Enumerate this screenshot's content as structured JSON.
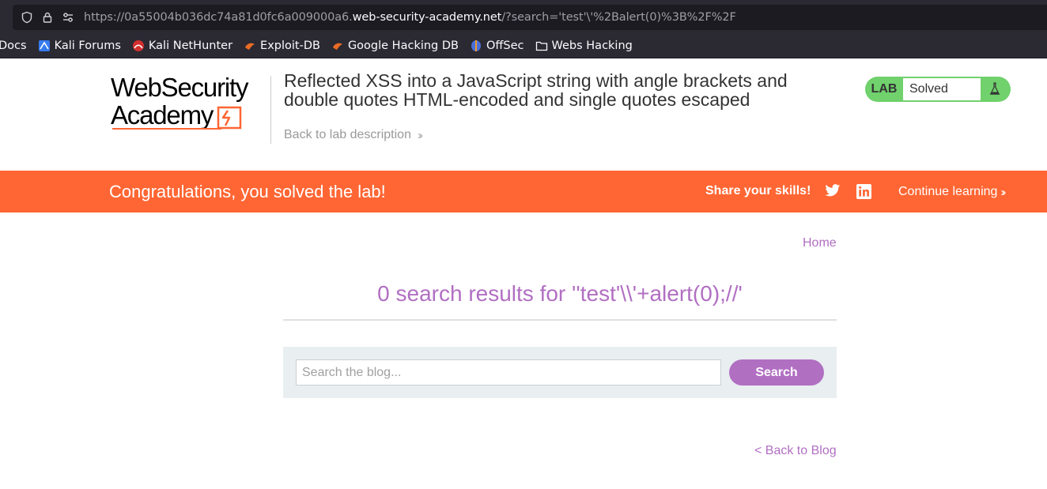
{
  "browser": {
    "url_prefix": "https://0a55004b036dc74a81d0fc6a009000a6.",
    "url_host": "web-security-academy.net",
    "url_path": "/?search='test'\\'%2Balert(0)%3B%2F%2F",
    "bookmarks": [
      {
        "label": "Docs",
        "icon": "docs-icon"
      },
      {
        "label": "Kali Forums",
        "icon": "kali-forums-icon"
      },
      {
        "label": "Kali NetHunter",
        "icon": "kali-nethunter-icon"
      },
      {
        "label": "Exploit-DB",
        "icon": "exploit-db-icon"
      },
      {
        "label": "Google Hacking DB",
        "icon": "ghdb-icon"
      },
      {
        "label": "OffSec",
        "icon": "offsec-icon"
      },
      {
        "label": "Webs Hacking",
        "icon": "folder-icon"
      }
    ]
  },
  "lab": {
    "logo_line1": "WebSecurity",
    "logo_line2": "Academy",
    "title": "Reflected XSS into a JavaScript string with angle brackets and double quotes HTML-encoded and single quotes escaped",
    "back_link": "Back to lab description",
    "status_tag": "LAB",
    "status_text": "Solved"
  },
  "banner": {
    "message": "Congratulations, you solved the lab!",
    "share_label": "Share your skills!",
    "continue_label": "Continue learning"
  },
  "blog": {
    "home_link": "Home",
    "results_heading": "0 search results for ''test'\\\\'+alert(0);//'",
    "search_placeholder": "Search the blog...",
    "search_button": "Search",
    "back_link": "< Back to Blog"
  },
  "colors": {
    "accent_orange": "#ff6633",
    "link_purple": "#b16fc2",
    "solved_green": "#70d16d"
  }
}
